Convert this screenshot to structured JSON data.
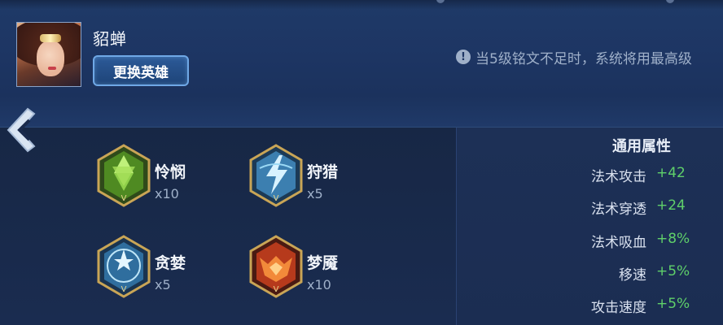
{
  "hero": {
    "name": "貂蝉",
    "change_button": "更换英雄"
  },
  "notice": {
    "icon": "info-icon",
    "text": "当5级铭文不足时，系统将用最高级"
  },
  "runes": [
    {
      "name": "怜悯",
      "count": "x10",
      "icon": "green-hexagram-rune-icon",
      "color": "#6fbf3a"
    },
    {
      "name": "狩猎",
      "count": "x5",
      "icon": "blue-lightning-rune-icon",
      "color": "#4aa6d8"
    },
    {
      "name": "贪婪",
      "count": "x5",
      "icon": "blue-star-rune-icon",
      "color": "#3f8fc8"
    },
    {
      "name": "梦魇",
      "count": "x10",
      "icon": "red-demon-rune-icon",
      "color": "#d8502a"
    }
  ],
  "stats": {
    "title": "通用属性",
    "items": [
      {
        "name": "法术攻击",
        "value": "+42"
      },
      {
        "name": "法术穿透",
        "value": "+24"
      },
      {
        "name": "法术吸血",
        "value": "+8%"
      },
      {
        "name": "移速",
        "value": "+5%"
      },
      {
        "name": "攻击速度",
        "value": "+5%"
      }
    ],
    "value_color": "#5fd06a"
  }
}
